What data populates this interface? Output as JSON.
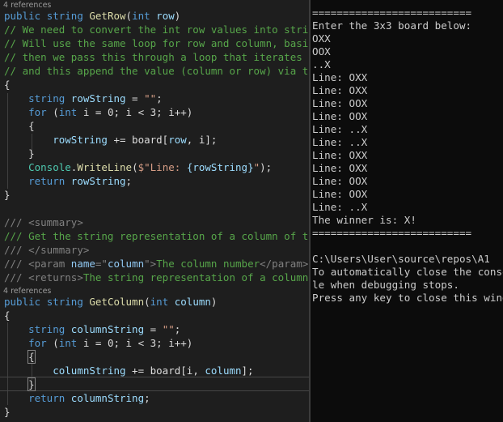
{
  "editor": {
    "refs": [
      "4 references",
      "4 references"
    ],
    "getrow": {
      "l1_public": "public",
      "l1_string": "string",
      "l1_name": "GetRow",
      "l1_open": "(",
      "l1_int": "int",
      "l1_param": "row",
      "l1_close": ")",
      "c1": "// We need to convert the int row values into strings",
      "c2": "// Will use the same loop for row and column, basically",
      "c3": "// then we pass this through a loop that iterates",
      "c4": "// and this append the value (column or row) via the loop",
      "brace_open": "{",
      "decl_string": "string",
      "decl_var": "rowString",
      "decl_eq": " = ",
      "decl_val": "\"\"",
      "decl_semi": ";",
      "for_kw": "for",
      "for_open": " (",
      "for_int": "int",
      "for_rest": " i = 0; i < 3; i++)",
      "inner_open": "{",
      "append_var": "rowString",
      "append_op": " += board[",
      "append_arg": "row",
      "append_tail": ", i];",
      "inner_close": "}",
      "console_type": "Console",
      "console_dot": ".",
      "console_method": "WriteLine",
      "console_open": "(",
      "console_str": "$\"Line: ",
      "console_interp": "{rowString}",
      "console_strend": "\"",
      "console_close": ");",
      "return_kw": "return",
      "return_var": "rowString",
      "return_semi": ";",
      "brace_close": "}"
    },
    "doc": {
      "d1_slash": "/// ",
      "d1_tag": "<summary>",
      "d2": "/// Get the string representation of a column of the board",
      "d3_slash": "/// ",
      "d3_tag": "</summary>",
      "d4_slash": "/// ",
      "d4_open": "<param ",
      "d4_attr": "name",
      "d4_eq": "=\"",
      "d4_val": "column",
      "d4_q": "\">",
      "d4_text": "The column number",
      "d4_close": "</param>",
      "d5_slash": "/// ",
      "d5_open": "<returns>",
      "d5_text": "The string representation of a column"
    },
    "getcol": {
      "l1_public": "public",
      "l1_string": "string",
      "l1_name": "GetColumn",
      "l1_open": "(",
      "l1_int": "int",
      "l1_param": "column",
      "l1_close": ")",
      "brace_open": "{",
      "decl_string": "string",
      "decl_var": "columnString",
      "decl_eq": " = ",
      "decl_val": "\"\"",
      "decl_semi": ";",
      "for_kw": "for",
      "for_open": " (",
      "for_int": "int",
      "for_rest": " i = 0; i < 3; i++)",
      "inner_open": "{",
      "append_var": "columnString",
      "append_op": " += board[i, ",
      "append_arg": "column",
      "append_tail": "];",
      "inner_close": "}",
      "return_kw": "return",
      "return_var": "columnString",
      "return_semi": ";",
      "brace_close": "}"
    }
  },
  "console": {
    "lines": [
      "==========================",
      "Enter the 3x3 board below:",
      "OXX",
      "OOX",
      "..X",
      "Line: OXX",
      "Line: OXX",
      "Line: OOX",
      "Line: OOX",
      "Line: ..X",
      "Line: ..X",
      "Line: OXX",
      "Line: OXX",
      "Line: OOX",
      "Line: OOX",
      "Line: ..X",
      "The winner is: X!",
      "==========================",
      "",
      "C:\\Users\\User\\source\\repos\\A1",
      "To automatically close the console",
      "le when debugging stops.",
      "Press any key to close this window"
    ]
  },
  "colors": {
    "editor_bg": "#1e1e1e",
    "console_bg": "#0c0c0c",
    "keyword": "#569cd6",
    "type": "#4ec9b0",
    "method": "#dcdcaa",
    "variable": "#9cdcfe",
    "comment": "#57a64a",
    "string": "#d69d85"
  }
}
